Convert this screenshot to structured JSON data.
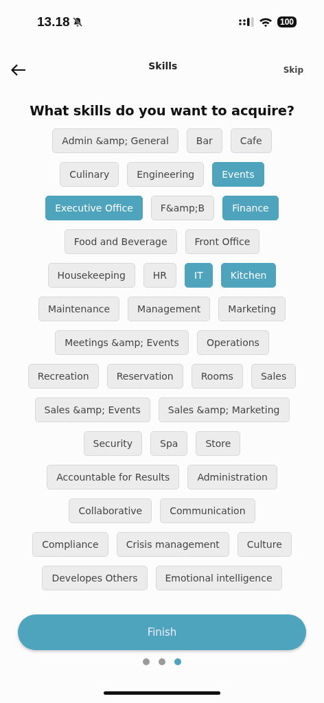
{
  "status_bar": {
    "time": "13.18",
    "battery": "100"
  },
  "header": {
    "title": "Skills",
    "skip": "Skip"
  },
  "question": "What skills do you want to acquire?",
  "skill_rows": [
    [
      {
        "label": "Admin &amp; General",
        "selected": false
      },
      {
        "label": "Bar",
        "selected": false
      },
      {
        "label": "Cafe",
        "selected": false
      }
    ],
    [
      {
        "label": "Culinary",
        "selected": false
      },
      {
        "label": "Engineering",
        "selected": false
      },
      {
        "label": "Events",
        "selected": true
      }
    ],
    [
      {
        "label": "Executive Office",
        "selected": true
      },
      {
        "label": "F&amp;B",
        "selected": false
      },
      {
        "label": "Finance",
        "selected": true
      }
    ],
    [
      {
        "label": "Food and Beverage",
        "selected": false
      },
      {
        "label": "Front Office",
        "selected": false
      }
    ],
    [
      {
        "label": "Housekeeping",
        "selected": false
      },
      {
        "label": "HR",
        "selected": false
      },
      {
        "label": "IT",
        "selected": true
      },
      {
        "label": "Kitchen",
        "selected": true
      }
    ],
    [
      {
        "label": "Maintenance",
        "selected": false
      },
      {
        "label": "Management",
        "selected": false
      },
      {
        "label": "Marketing",
        "selected": false
      }
    ],
    [
      {
        "label": "Meetings &amp; Events",
        "selected": false
      },
      {
        "label": "Operations",
        "selected": false
      }
    ],
    [
      {
        "label": "Recreation",
        "selected": false
      },
      {
        "label": "Reservation",
        "selected": false
      },
      {
        "label": "Rooms",
        "selected": false
      },
      {
        "label": "Sales",
        "selected": false
      }
    ],
    [
      {
        "label": "Sales &amp; Events",
        "selected": false
      },
      {
        "label": "Sales &amp; Marketing",
        "selected": false
      }
    ],
    [
      {
        "label": "Security",
        "selected": false
      },
      {
        "label": "Spa",
        "selected": false
      },
      {
        "label": "Store",
        "selected": false
      }
    ],
    [
      {
        "label": "Accountable for Results",
        "selected": false
      },
      {
        "label": "Administration",
        "selected": false
      }
    ],
    [
      {
        "label": "Collaborative",
        "selected": false
      },
      {
        "label": "Communication",
        "selected": false
      }
    ],
    [
      {
        "label": "Compliance",
        "selected": false
      },
      {
        "label": "Crisis management",
        "selected": false
      },
      {
        "label": "Culture",
        "selected": false
      }
    ],
    [
      {
        "label": "Developes Others",
        "selected": false
      },
      {
        "label": "Emotional intelligence",
        "selected": false
      }
    ]
  ],
  "finish_button": "Finish",
  "page_dots": [
    {
      "selected": false
    },
    {
      "selected": false
    },
    {
      "selected": true
    }
  ]
}
